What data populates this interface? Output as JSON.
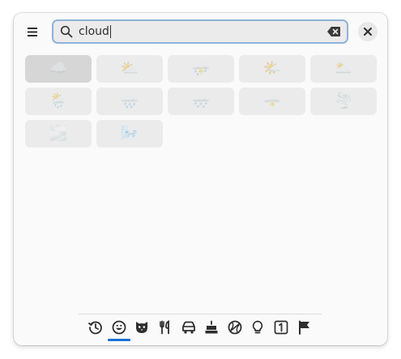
{
  "search": {
    "query": "cloud"
  },
  "results": [
    {
      "emoji": "☁️",
      "name": "cloud"
    },
    {
      "emoji": "⛅",
      "name": "sun behind cloud"
    },
    {
      "emoji": "⛈️",
      "name": "cloud with lightning and rain"
    },
    {
      "emoji": "🌤️",
      "name": "sun behind small cloud"
    },
    {
      "emoji": "🌥️",
      "name": "sun behind large cloud"
    },
    {
      "emoji": "🌦️",
      "name": "sun behind rain cloud"
    },
    {
      "emoji": "🌧️",
      "name": "cloud with rain"
    },
    {
      "emoji": "🌨️",
      "name": "cloud with snow"
    },
    {
      "emoji": "🌩️",
      "name": "cloud with lightning"
    },
    {
      "emoji": "🌪️",
      "name": "tornado"
    },
    {
      "emoji": "🌫️",
      "name": "fog"
    },
    {
      "emoji": "🌬️",
      "name": "wind face"
    }
  ],
  "categories": [
    {
      "icon": "recent-history-icon"
    },
    {
      "icon": "smiley-face-icon"
    },
    {
      "icon": "animal-face-icon"
    },
    {
      "icon": "fork-knife-icon"
    },
    {
      "icon": "car-icon"
    },
    {
      "icon": "birthday-cake-icon"
    },
    {
      "icon": "ball-icon"
    },
    {
      "icon": "lightbulb-icon"
    },
    {
      "icon": "number-one-icon"
    },
    {
      "icon": "flag-icon"
    }
  ],
  "colors": {
    "accent": "#1c71d8",
    "focus_border": "#8eb2d8",
    "cell_bg": "#ebebeb",
    "cell_selected_bg": "#d6d6d6"
  }
}
